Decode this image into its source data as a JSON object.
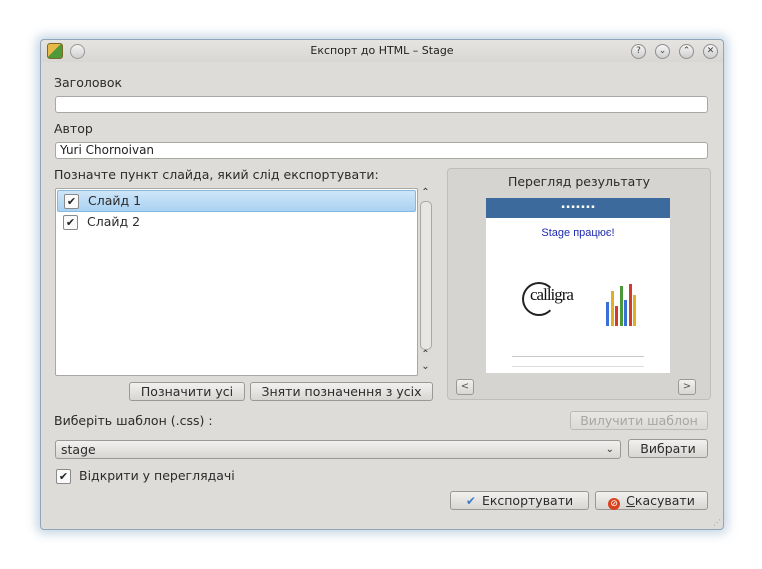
{
  "window": {
    "title": "Експорт до HTML – Stage",
    "controls": [
      "help-icon",
      "minimize-icon",
      "maximize-icon",
      "close-icon"
    ]
  },
  "form": {
    "title_label": "Заголовок",
    "title_value": "",
    "author_label": "Автор",
    "author_value": "Yuri Chornoivan",
    "slides_label": "Позначте пункт слайда, який слід експортувати:",
    "slides": [
      {
        "label": "Слайд 1",
        "checked": true,
        "selected": true
      },
      {
        "label": "Слайд 2",
        "checked": true,
        "selected": false
      }
    ],
    "select_all": "Позначити усі",
    "deselect_all": "Зняти позначення з усіх"
  },
  "preview": {
    "label": "Перегляд результату",
    "slide_title": "Stage працює!",
    "logo_text": "calligra"
  },
  "template": {
    "label": "Виберіть шаблон (.css) :",
    "remove_button": "Вилучити шаблон",
    "selected": "stage",
    "browse_button": "Вибрати"
  },
  "open_in_browser": {
    "label": "Відкрити у переглядачі",
    "checked": true
  },
  "actions": {
    "export_button": "Експортувати",
    "cancel_mnemonic": "С",
    "cancel_rest": "касувати"
  },
  "colors": {
    "accent": "#3f7fc4",
    "selection": "#a9d2f2",
    "slide_header": "#3c6a9c",
    "slide_title": "#1e2ab0"
  },
  "chart_bars": [
    {
      "value": 0.55,
      "color": "#3a6ed8"
    },
    {
      "value": 0.8,
      "color": "#e0b020"
    },
    {
      "value": 0.45,
      "color": "#d23a2a"
    },
    {
      "value": 0.9,
      "color": "#4a9a3a"
    },
    {
      "value": 0.6,
      "color": "#3a6ed8"
    },
    {
      "value": 0.95,
      "color": "#d23a2a"
    },
    {
      "value": 0.7,
      "color": "#e0b020"
    }
  ]
}
